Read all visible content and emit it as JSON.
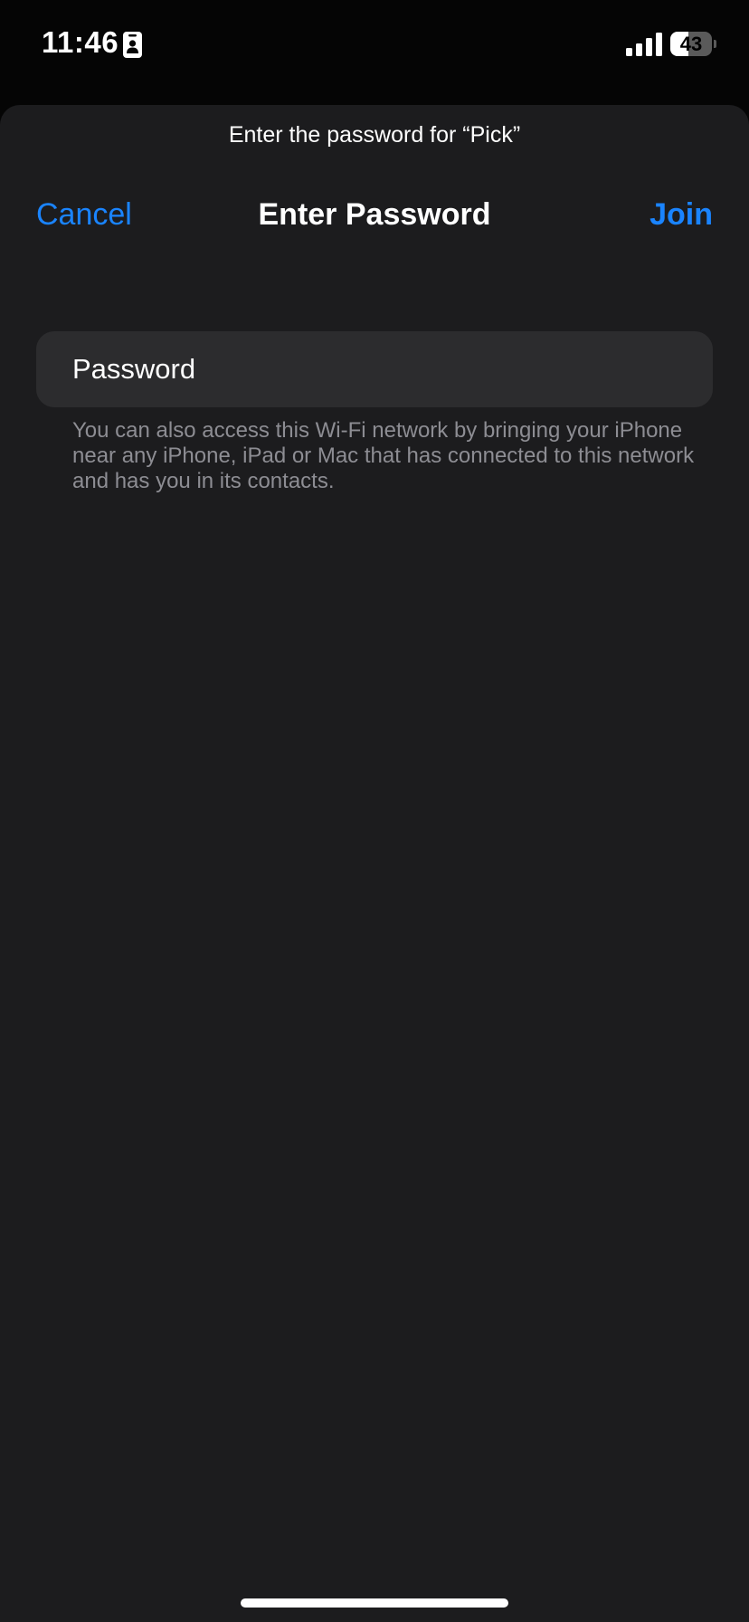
{
  "status_bar": {
    "time": "11:46",
    "battery_level": "43",
    "battery_fraction": 0.43,
    "icons": [
      "id-card-icon",
      "cellular-signal-icon",
      "battery-icon"
    ]
  },
  "sheet": {
    "prompt": "Enter the password for “Pick”",
    "nav": {
      "cancel_label": "Cancel",
      "title": "Enter Password",
      "join_label": "Join"
    },
    "password_field": {
      "placeholder": "Password",
      "value": ""
    },
    "footer_note": "You can also access this Wi-Fi network by bringing your iPhone near any iPhone, iPad or Mac that has connected to this network and has you in its contacts."
  },
  "colors": {
    "accent": "#1a84ff",
    "sheet_background": "#1c1c1e",
    "field_background": "#2c2c2e",
    "secondary_text": "#8d8d93"
  }
}
